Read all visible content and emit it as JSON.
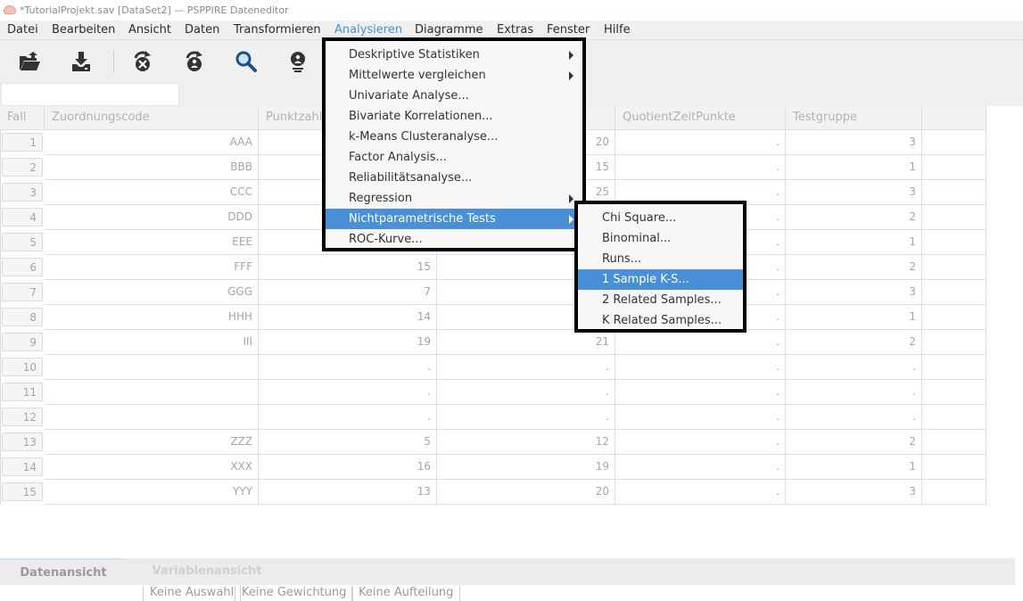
{
  "window": {
    "title": "*TutorialProjekt.sav [DataSet2] — PSPPIRE Dateneditor"
  },
  "menubar": {
    "items": [
      "Datei",
      "Bearbeiten",
      "Ansicht",
      "Daten",
      "Transformieren",
      "Analysieren",
      "Diagramme",
      "Extras",
      "Fenster",
      "Hilfe"
    ],
    "active": "Analysieren"
  },
  "toolbar": {
    "icons": [
      "open-file-icon",
      "save-download-icon",
      "goto-case-icon",
      "goto-variable-icon",
      "find-icon",
      "variables-info-icon"
    ]
  },
  "grid": {
    "columns": [
      "Fall",
      "Zuordnungscode",
      "Punktzahl",
      "",
      "QuotientZeitPunkte",
      "Testgruppe",
      ""
    ],
    "rows": [
      {
        "n": "1",
        "code": "AAA",
        "punkte": "",
        "c3": "20",
        "quot": ".",
        "gruppe": "3"
      },
      {
        "n": "2",
        "code": "BBB",
        "punkte": "",
        "c3": "15",
        "quot": ".",
        "gruppe": "1"
      },
      {
        "n": "3",
        "code": "CCC",
        "punkte": "",
        "c3": "25",
        "quot": ".",
        "gruppe": "3"
      },
      {
        "n": "4",
        "code": "DDD",
        "punkte": "",
        "c3": "",
        "quot": ".",
        "gruppe": "2"
      },
      {
        "n": "5",
        "code": "EEE",
        "punkte": "",
        "c3": "",
        "quot": ".",
        "gruppe": "1"
      },
      {
        "n": "6",
        "code": "FFF",
        "punkte": "15",
        "c3": "",
        "quot": ".",
        "gruppe": "2"
      },
      {
        "n": "7",
        "code": "GGG",
        "punkte": "7",
        "c3": "",
        "quot": ".",
        "gruppe": "3"
      },
      {
        "n": "8",
        "code": "HHH",
        "punkte": "14",
        "c3": "",
        "quot": ".",
        "gruppe": "1"
      },
      {
        "n": "9",
        "code": "III",
        "punkte": "19",
        "c3": "21",
        "quot": ".",
        "gruppe": "2"
      },
      {
        "n": "10",
        "code": "",
        "punkte": ".",
        "c3": ".",
        "quot": ".",
        "gruppe": "."
      },
      {
        "n": "11",
        "code": "",
        "punkte": ".",
        "c3": ".",
        "quot": ".",
        "gruppe": "."
      },
      {
        "n": "12",
        "code": "",
        "punkte": ".",
        "c3": ".",
        "quot": ".",
        "gruppe": "."
      },
      {
        "n": "13",
        "code": "ZZZ",
        "punkte": "5",
        "c3": "12",
        "quot": ".",
        "gruppe": "2"
      },
      {
        "n": "14",
        "code": "XXX",
        "punkte": "16",
        "c3": "19",
        "quot": ".",
        "gruppe": "1"
      },
      {
        "n": "15",
        "code": "YYY",
        "punkte": "13",
        "c3": "20",
        "quot": ".",
        "gruppe": "3"
      }
    ]
  },
  "analyze_menu": {
    "items": [
      {
        "label": "Deskriptive Statistiken",
        "submenu": true
      },
      {
        "label": "Mittelwerte vergleichen",
        "submenu": true
      },
      {
        "label": "Univariate Analyse...",
        "submenu": false
      },
      {
        "label": "Bivariate Korrelationen...",
        "submenu": false
      },
      {
        "label": "k-Means Clusteranalyse...",
        "submenu": false
      },
      {
        "label": "Factor Analysis...",
        "submenu": false
      },
      {
        "label": "Reliabilitätsanalyse...",
        "submenu": false
      },
      {
        "label": "Regression",
        "submenu": true
      },
      {
        "label": "Nichtparametrische Tests",
        "submenu": true,
        "highlighted": true
      },
      {
        "label": "ROC-Kurve...",
        "submenu": false
      }
    ]
  },
  "nonparam_submenu": {
    "items": [
      {
        "label": "Chi Square..."
      },
      {
        "label": "Binominal..."
      },
      {
        "label": "Runs..."
      },
      {
        "label": "1 Sample K-S...",
        "highlighted": true
      },
      {
        "label": "2 Related Samples..."
      },
      {
        "label": "K Related Samples..."
      }
    ]
  },
  "tabs": {
    "active": "Datenansicht",
    "inactive": "Variablenansicht"
  },
  "status": {
    "filter": "Keine Auswahl",
    "weight": "Keine Gewichtung",
    "split": "Keine Aufteilung"
  },
  "colors": {
    "accent": "#4a90d9",
    "menu_bg": "#efefef"
  }
}
